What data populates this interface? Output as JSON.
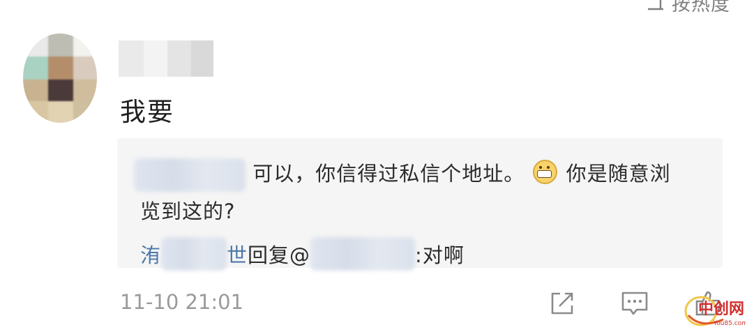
{
  "header": {
    "sort_label": "按热度"
  },
  "comment": {
    "text": "我要",
    "timestamp": "11-10 21:01"
  },
  "replies": {
    "line1_text": "可以，你信得过私信个地址。",
    "line1_tail": "你是随意浏",
    "line2_text": "览到这的?",
    "line3_name_start": "洧",
    "line3_name_end": "世",
    "line3_action": "回复@",
    "line3_text": ":对啊"
  },
  "icons": {
    "sort": "sort-icon",
    "share": "share-icon",
    "comment": "comment-icon",
    "like": "thumbs-up-icon",
    "emoji": "grin-emoji-icon"
  },
  "colors": {
    "link": "#4e78a8",
    "muted": "#9a9a9a",
    "reply_bg": "#f5f5f5"
  }
}
